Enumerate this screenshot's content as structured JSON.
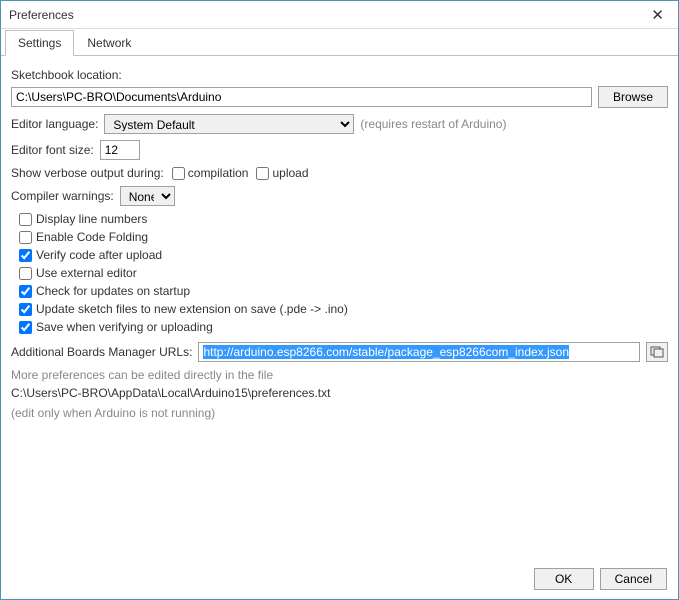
{
  "window": {
    "title": "Preferences"
  },
  "tabs": {
    "settings": "Settings",
    "network": "Network"
  },
  "sketchbook": {
    "label": "Sketchbook location:",
    "path": "C:\\Users\\PC-BRO\\Documents\\Arduino",
    "browse": "Browse"
  },
  "language": {
    "label": "Editor language:",
    "value": "System Default",
    "note": "(requires restart of Arduino)"
  },
  "fontsize": {
    "label": "Editor font size:",
    "value": "12"
  },
  "verbose": {
    "label": "Show verbose output during:",
    "compilation": "compilation",
    "upload": "upload"
  },
  "warnings": {
    "label": "Compiler warnings:",
    "value": "None"
  },
  "checks": {
    "display_line_numbers": "Display line numbers",
    "enable_code_folding": "Enable Code Folding",
    "verify_after_upload": "Verify code after upload",
    "external_editor": "Use external editor",
    "check_updates": "Check for updates on startup",
    "update_sketch_ext": "Update sketch files to new extension on save (.pde -> .ino)",
    "save_verify_upload": "Save when verifying or uploading"
  },
  "boards": {
    "label": "Additional Boards Manager URLs:",
    "url": "http://arduino.esp8266.com/stable/package_esp8266com_index.json"
  },
  "more_prefs": {
    "note1": "More preferences can be edited directly in the file",
    "path": "C:\\Users\\PC-BRO\\AppData\\Local\\Arduino15\\preferences.txt",
    "note2": "(edit only when Arduino is not running)"
  },
  "footer": {
    "ok": "OK",
    "cancel": "Cancel"
  }
}
